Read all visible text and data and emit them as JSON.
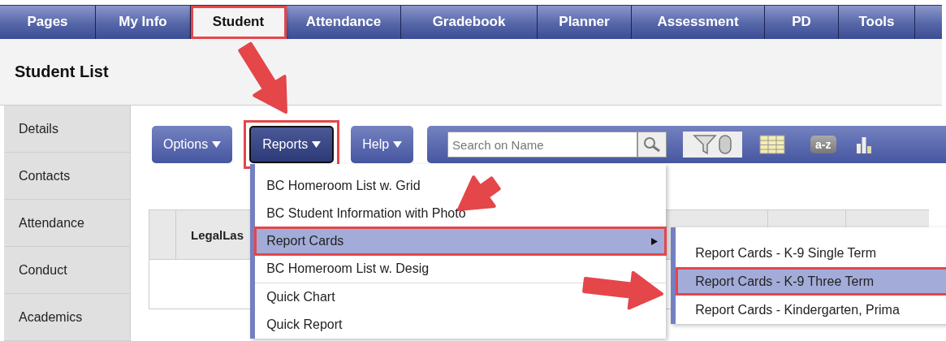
{
  "nav_tabs": [
    {
      "label": "Pages",
      "selected": false,
      "callout": false
    },
    {
      "label": "My Info",
      "selected": false,
      "callout": false
    },
    {
      "label": "Student",
      "selected": true,
      "callout": true
    },
    {
      "label": "Attendance",
      "selected": false,
      "callout": false
    },
    {
      "label": "Gradebook",
      "selected": false,
      "callout": false
    },
    {
      "label": "Planner",
      "selected": false,
      "callout": false
    },
    {
      "label": "Assessment",
      "selected": false,
      "callout": false
    },
    {
      "label": "PD",
      "selected": false,
      "callout": false
    },
    {
      "label": "Tools",
      "selected": false,
      "callout": false
    }
  ],
  "page_title": "Student List",
  "sidebar": {
    "items": [
      "Details",
      "Contacts",
      "Attendance",
      "Conduct",
      "Academics"
    ]
  },
  "toolbar": {
    "buttons": [
      {
        "label": "Options",
        "selected": false,
        "callout": false
      },
      {
        "label": "Reports",
        "selected": true,
        "callout": true
      },
      {
        "label": "Help",
        "selected": false,
        "callout": false
      }
    ],
    "search": {
      "placeholder": "Search on Name"
    },
    "sort_label": "a-z"
  },
  "table": {
    "columns": [
      "LegalLas"
    ]
  },
  "reports_menu": {
    "items": [
      {
        "label": "BC Homeroom List w. Grid",
        "kind": "item",
        "selected": false,
        "callout": false
      },
      {
        "label": "BC Student Information with Photo",
        "kind": "item",
        "selected": false,
        "callout": false
      },
      {
        "label": "Report Cards",
        "kind": "submenu",
        "selected": true,
        "callout": true
      },
      {
        "label": "BC Homeroom List w. Desig",
        "kind": "item",
        "selected": false,
        "callout": false
      },
      {
        "label": "Quick Chart",
        "kind": "item",
        "selected": false,
        "callout": false
      },
      {
        "label": "Quick Report",
        "kind": "item",
        "selected": false,
        "callout": false
      }
    ],
    "submenu": [
      {
        "label": "Report Cards - K-9 Single Term",
        "selected": false,
        "callout": false
      },
      {
        "label": "Report Cards - K-9 Three Term",
        "selected": true,
        "callout": true
      },
      {
        "label": "Report Cards - Kindergarten, Prima",
        "selected": false,
        "callout": false
      }
    ]
  }
}
